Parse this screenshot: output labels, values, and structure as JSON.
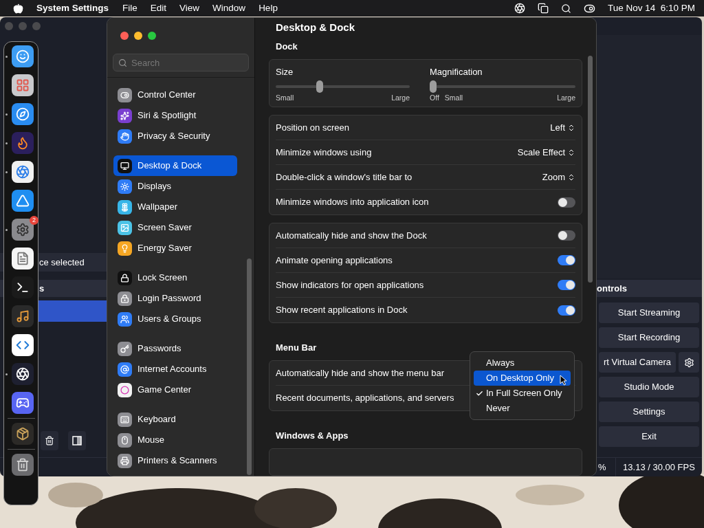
{
  "menubar": {
    "app": "System Settings",
    "menus": [
      "File",
      "Edit",
      "View",
      "Window",
      "Help"
    ],
    "clock": "Tue Nov 14  6:10 PM"
  },
  "dock": {
    "groups": [
      [
        {
          "running": true
        },
        {
          "running": false
        },
        {
          "running": true
        },
        {
          "running": true
        },
        {
          "running": true
        },
        {
          "running": false
        },
        {
          "running": true,
          "badge": "2"
        },
        {
          "running": false
        },
        {
          "running": false
        },
        {
          "running": false
        },
        {
          "running": false
        },
        {
          "running": true
        },
        {
          "running": false
        }
      ],
      [
        {
          "running": false
        }
      ],
      [
        {
          "running": false
        }
      ]
    ]
  },
  "obs": {
    "sources_status": "ce selected",
    "list_header": "s",
    "list_rows": [
      {
        "selected": true
      }
    ],
    "controls_header": "ontrols",
    "controls": [
      {
        "kind": "button",
        "label": "Start Streaming"
      },
      {
        "kind": "button",
        "label": "Start Recording"
      },
      {
        "kind": "button_with_gear",
        "label": "rt Virtual Camera"
      },
      {
        "kind": "button",
        "label": "Studio Mode"
      },
      {
        "kind": "button",
        "label": "Settings"
      },
      {
        "kind": "button",
        "label": "Exit"
      }
    ],
    "status": [
      "%",
      "13.13 / 30.00 FPS"
    ]
  },
  "settings": {
    "search": {
      "placeholder": "Search"
    },
    "sidebar": {
      "groups": [
        [
          {
            "label": "Control Center",
            "selected": false
          },
          {
            "label": "Siri & Spotlight",
            "selected": false
          },
          {
            "label": "Privacy & Security",
            "selected": false
          }
        ],
        [
          {
            "label": "Desktop & Dock",
            "selected": true
          },
          {
            "label": "Displays",
            "selected": false
          },
          {
            "label": "Wallpaper",
            "selected": false
          },
          {
            "label": "Screen Saver",
            "selected": false
          },
          {
            "label": "Energy Saver",
            "selected": false
          }
        ],
        [
          {
            "label": "Lock Screen",
            "selected": false
          },
          {
            "label": "Login Password",
            "selected": false
          },
          {
            "label": "Users & Groups",
            "selected": false
          }
        ],
        [
          {
            "label": "Passwords",
            "selected": false
          },
          {
            "label": "Internet Accounts",
            "selected": false
          },
          {
            "label": "Game Center",
            "selected": false
          }
        ],
        [
          {
            "label": "Keyboard",
            "selected": false
          },
          {
            "label": "Mouse",
            "selected": false
          },
          {
            "label": "Printers & Scanners",
            "selected": false
          }
        ]
      ]
    },
    "title": "Desktop & Dock",
    "sections": [
      {
        "title": "Dock",
        "cards": [
          {
            "kind": "sliders",
            "sliders": [
              {
                "label": "Size",
                "level": 0.32,
                "marks": [
                  "Small",
                  "Large"
                ]
              },
              {
                "label": "Magnification",
                "level": 0,
                "marks": [
                  "Off",
                  "Small",
                  "Large"
                ]
              }
            ]
          },
          {
            "kind": "rows",
            "rows": [
              {
                "kind": "popup",
                "label": "Position on screen",
                "value": "Left"
              },
              {
                "kind": "popup",
                "label": "Minimize windows using",
                "value": "Scale Effect"
              },
              {
                "kind": "popup",
                "label": "Double-click a window's title bar to",
                "value": "Zoom"
              },
              {
                "kind": "toggle",
                "label": "Minimize windows into application icon",
                "on": false
              }
            ]
          },
          {
            "kind": "rows",
            "rows": [
              {
                "kind": "toggle",
                "label": "Automatically hide and show the Dock",
                "on": false
              },
              {
                "kind": "toggle",
                "label": "Animate opening applications",
                "on": true
              },
              {
                "kind": "toggle",
                "label": "Show indicators for open applications",
                "on": true
              },
              {
                "kind": "toggle",
                "label": "Show recent applications in Dock",
                "on": true
              }
            ]
          }
        ]
      },
      {
        "title": "Menu Bar",
        "cards": [
          {
            "kind": "rows",
            "rows": [
              {
                "kind": "popup",
                "label": "Automatically hide and show the menu bar"
              },
              {
                "kind": "popup",
                "label": "Recent documents, applications, and servers"
              }
            ]
          }
        ]
      },
      {
        "title": "Windows & Apps",
        "cards": [
          {
            "kind": "partial"
          }
        ]
      }
    ]
  },
  "menu": {
    "items": [
      {
        "label": "Always",
        "selected": false,
        "checked": false
      },
      {
        "label": "On Desktop Only",
        "selected": true,
        "checked": false
      },
      {
        "label": "In Full Screen Only",
        "selected": false,
        "checked": true
      },
      {
        "label": "Never",
        "selected": false,
        "checked": false
      }
    ]
  }
}
